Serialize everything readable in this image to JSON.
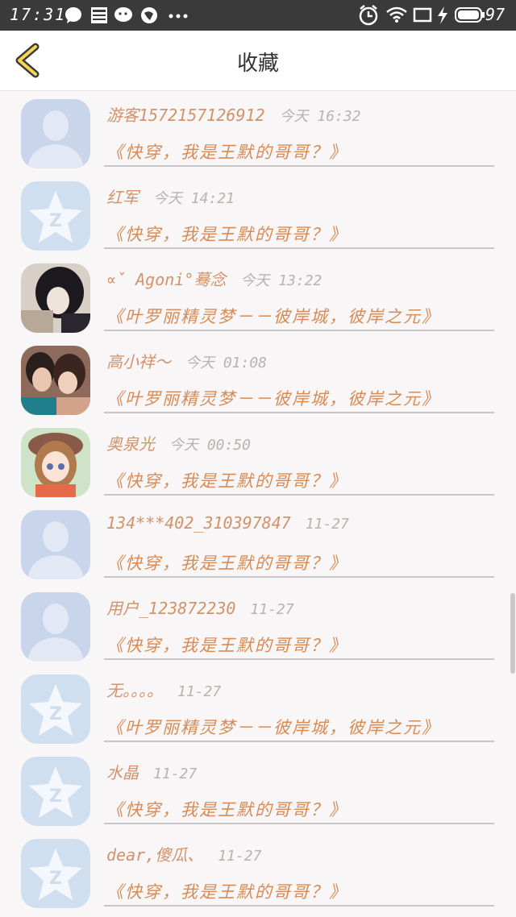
{
  "status_bar": {
    "time": "17:31",
    "battery": "97",
    "icons": [
      "chat-bubble-icon",
      "news-icon",
      "wechat-icon",
      "ball-icon",
      "more-dots-icon",
      "alarm-icon",
      "wifi-icon",
      "screen-icon",
      "charge-icon",
      "battery-icon"
    ]
  },
  "header": {
    "title": "收藏",
    "back_icon": "chevron-left-icon"
  },
  "items": [
    {
      "user": "游客1572157126912",
      "time": "今天 16:32",
      "book": "《快穿，我是王默的哥哥？》",
      "avatar": "default-person"
    },
    {
      "user": "红军",
      "time": "今天 14:21",
      "book": "《快穿，我是王默的哥哥？》",
      "avatar": "star-logo"
    },
    {
      "user": "∝ˇ Agoni°蓦念",
      "time": "今天 13:22",
      "book": "《叶罗丽精灵梦－－彼岸城，彼岸之元》",
      "avatar": "photo-dark"
    },
    {
      "user": "高小祥～",
      "time": "今天 01:08",
      "book": "《叶罗丽精灵梦－－彼岸城，彼岸之元》",
      "avatar": "photo-couple"
    },
    {
      "user": "奥泉光",
      "time": "今天 00:50",
      "book": "《快穿，我是王默的哥哥？》",
      "avatar": "anime-girl"
    },
    {
      "user": "134***402_310397847",
      "time": "11-27",
      "book": "《快穿，我是王默的哥哥？》",
      "avatar": "default-person"
    },
    {
      "user": "用户_123872230",
      "time": "11-27",
      "book": "《快穿，我是王默的哥哥？》",
      "avatar": "default-person"
    },
    {
      "user": "无。。。。",
      "time": "11-27",
      "book": "《叶罗丽精灵梦－－彼岸城，彼岸之元》",
      "avatar": "star-logo"
    },
    {
      "user": "水晶",
      "time": "11-27",
      "book": "《快穿，我是王默的哥哥？》",
      "avatar": "star-logo"
    },
    {
      "user": "dear,傻瓜、",
      "time": "11-27",
      "book": "《快穿，我是王默的哥哥？》",
      "avatar": "star-logo"
    }
  ]
}
